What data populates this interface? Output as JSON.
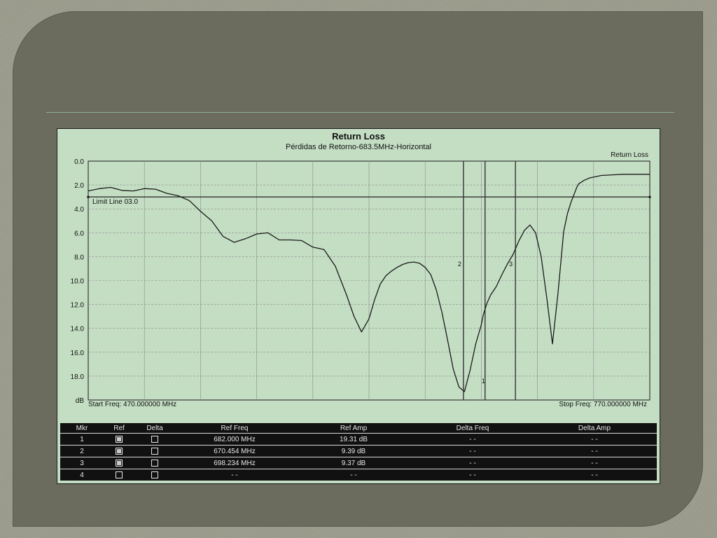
{
  "chart_data": {
    "type": "line",
    "title": "Return Loss",
    "subtitle": "Pérdidas de Retorno-683.5MHz-Horizontal",
    "series_label": "Return Loss",
    "y_unit": "dB",
    "ylim": [
      0,
      20
    ],
    "y_inverted": true,
    "y_ticks": [
      "0.0",
      "2.0",
      "4.0",
      "6.0",
      "8.0",
      "10.0",
      "12.0",
      "14.0",
      "16.0",
      "18.0"
    ],
    "xlim": [
      470,
      770
    ],
    "grid": true,
    "limit_line": {
      "label": "Limit Line 03.0",
      "value": 3.0
    },
    "start_freq": "Start Freq: 470.000000 MHz",
    "stop_freq": "Stop Freq: 770.000000 MHz",
    "markers": [
      {
        "id": "1",
        "x": 682.0
      },
      {
        "id": "2",
        "x": 670.454
      },
      {
        "id": "3",
        "x": 698.234
      }
    ],
    "series": [
      {
        "x": [
          470,
          476,
          482,
          488,
          494,
          500,
          506,
          512,
          518,
          524,
          530,
          536,
          542,
          548,
          554,
          560,
          566,
          572,
          578,
          584,
          590,
          596,
          602,
          608,
          612,
          616,
          620,
          623,
          626,
          629,
          632,
          635,
          638,
          641,
          644,
          647,
          650,
          653,
          656,
          659,
          662,
          665,
          668,
          671,
          674,
          677,
          680,
          681,
          682,
          683,
          685,
          688,
          691,
          694,
          697,
          700,
          703,
          706,
          709,
          712,
          715,
          718,
          721,
          724,
          726,
          728,
          729,
          730,
          731,
          732,
          735,
          738,
          741,
          744,
          750,
          756,
          762,
          770
        ],
        "y": [
          2.5,
          2.3,
          2.2,
          2.45,
          2.5,
          2.3,
          2.35,
          2.7,
          2.9,
          3.3,
          4.2,
          5.0,
          6.3,
          6.8,
          6.5,
          6.1,
          6.0,
          6.6,
          6.6,
          6.65,
          7.2,
          7.4,
          8.8,
          11.2,
          13.0,
          14.3,
          13.2,
          11.6,
          10.3,
          9.6,
          9.2,
          8.9,
          8.65,
          8.5,
          8.45,
          8.55,
          8.9,
          9.5,
          10.8,
          12.7,
          15.0,
          17.4,
          18.9,
          19.3,
          17.5,
          15.3,
          13.7,
          12.9,
          12.4,
          11.9,
          11.2,
          10.5,
          9.5,
          8.6,
          7.8,
          6.7,
          5.8,
          5.35,
          6.0,
          8.0,
          11.5,
          15.3,
          11.0,
          5.9,
          4.4,
          3.4,
          3.0,
          2.6,
          2.2,
          1.9,
          1.6,
          1.4,
          1.3,
          1.2,
          1.15,
          1.1,
          1.1,
          1.1
        ]
      }
    ]
  },
  "table": {
    "headers": [
      "Mkr",
      "Ref",
      "Delta",
      "Ref Freq",
      "Ref Amp",
      "Delta Freq",
      "Delta Amp"
    ],
    "rows": [
      {
        "mkr": "1",
        "ref": true,
        "delta": false,
        "ref_freq": "682.000 MHz",
        "ref_amp": "19.31 dB",
        "delta_freq": "- -",
        "delta_amp": "- -"
      },
      {
        "mkr": "2",
        "ref": true,
        "delta": false,
        "ref_freq": "670.454 MHz",
        "ref_amp": "9.39 dB",
        "delta_freq": "- -",
        "delta_amp": "- -"
      },
      {
        "mkr": "3",
        "ref": true,
        "delta": false,
        "ref_freq": "698.234 MHz",
        "ref_amp": "9.37 dB",
        "delta_freq": "- -",
        "delta_amp": "- -"
      },
      {
        "mkr": "4",
        "ref": false,
        "delta": false,
        "ref_freq": "- -",
        "ref_amp": "- -",
        "delta_freq": "- -",
        "delta_amp": "- -"
      }
    ]
  },
  "colors": {
    "panel_bg": "#c4dec4",
    "trace": "#1a1a1a",
    "grid": "#8a8a8a",
    "table_bg": "#111111"
  }
}
